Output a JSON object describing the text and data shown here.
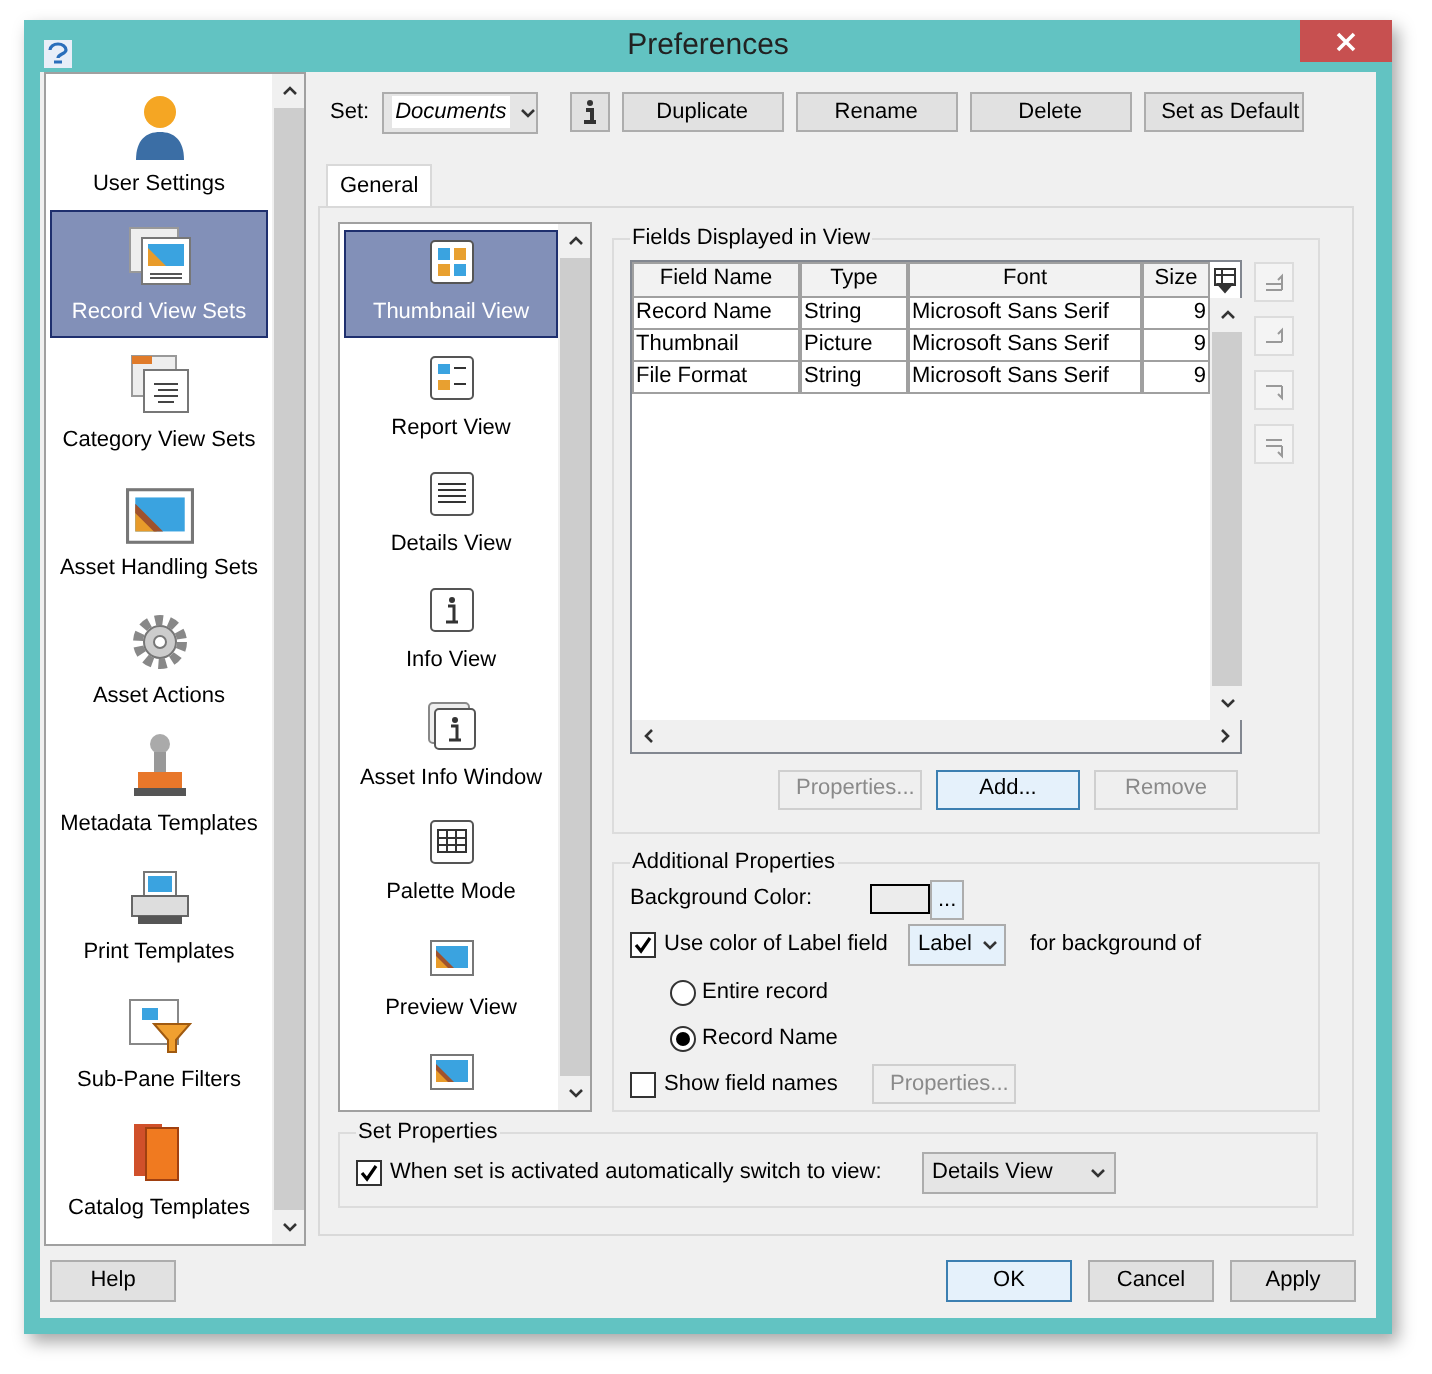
{
  "window": {
    "title": "Preferences"
  },
  "sidebar": {
    "items": [
      {
        "label": "User Settings",
        "selected": false
      },
      {
        "label": "Record View Sets",
        "selected": true
      },
      {
        "label": "Category View Sets",
        "selected": false
      },
      {
        "label": "Asset Handling Sets",
        "selected": false
      },
      {
        "label": "Asset Actions",
        "selected": false
      },
      {
        "label": "Metadata Templates",
        "selected": false
      },
      {
        "label": "Print Templates",
        "selected": false
      },
      {
        "label": "Sub-Pane Filters",
        "selected": false
      },
      {
        "label": "Catalog Templates",
        "selected": false
      }
    ]
  },
  "set_bar": {
    "label": "Set:",
    "value": "Documents",
    "buttons": [
      "Duplicate",
      "Rename",
      "Delete",
      "Set as Default"
    ]
  },
  "tabs": [
    {
      "label": "General",
      "selected": true
    }
  ],
  "views": [
    {
      "label": "Thumbnail View",
      "selected": true
    },
    {
      "label": "Report View",
      "selected": false
    },
    {
      "label": "Details View",
      "selected": false
    },
    {
      "label": "Info View",
      "selected": false
    },
    {
      "label": "Asset Info Window",
      "selected": false
    },
    {
      "label": "Palette Mode",
      "selected": false
    },
    {
      "label": "Preview View",
      "selected": false
    }
  ],
  "fields_group": {
    "title": "Fields Displayed in View",
    "columns": [
      "Field Name",
      "Type",
      "Font",
      "Size"
    ],
    "rows": [
      [
        "Record Name",
        "String",
        "Microsoft Sans Serif",
        "9"
      ],
      [
        "Thumbnail",
        "Picture",
        "Microsoft Sans Serif",
        "9"
      ],
      [
        "File Format",
        "String",
        "Microsoft Sans Serif",
        "9"
      ]
    ],
    "buttons": [
      {
        "label": "Properties...",
        "disabled": true,
        "focused": false
      },
      {
        "label": "Add...",
        "disabled": false,
        "focused": true
      },
      {
        "label": "Remove",
        "disabled": true,
        "focused": false
      }
    ]
  },
  "additional": {
    "title": "Additional Properties",
    "background_label": "Background Color:",
    "color_button": "...",
    "use_label": {
      "label": "Use color of Label field",
      "checked": true
    },
    "label_select": "Label",
    "for_text": "for background of",
    "radios": [
      {
        "label": "Entire record",
        "selected": false
      },
      {
        "label": "Record Name",
        "selected": true
      }
    ],
    "show_names": {
      "label": "Show field names",
      "checked": false
    },
    "properties_button": {
      "label": "Properties...",
      "disabled": true
    }
  },
  "set_properties": {
    "title": "Set Properties",
    "auto_switch": {
      "label": "When set is activated automatically switch to view:",
      "checked": true
    },
    "view_select": "Details View"
  },
  "footer": {
    "help": "Help",
    "buttons": [
      {
        "label": "OK",
        "focused": true
      },
      {
        "label": "Cancel",
        "focused": false
      },
      {
        "label": "Apply",
        "focused": false
      }
    ]
  }
}
